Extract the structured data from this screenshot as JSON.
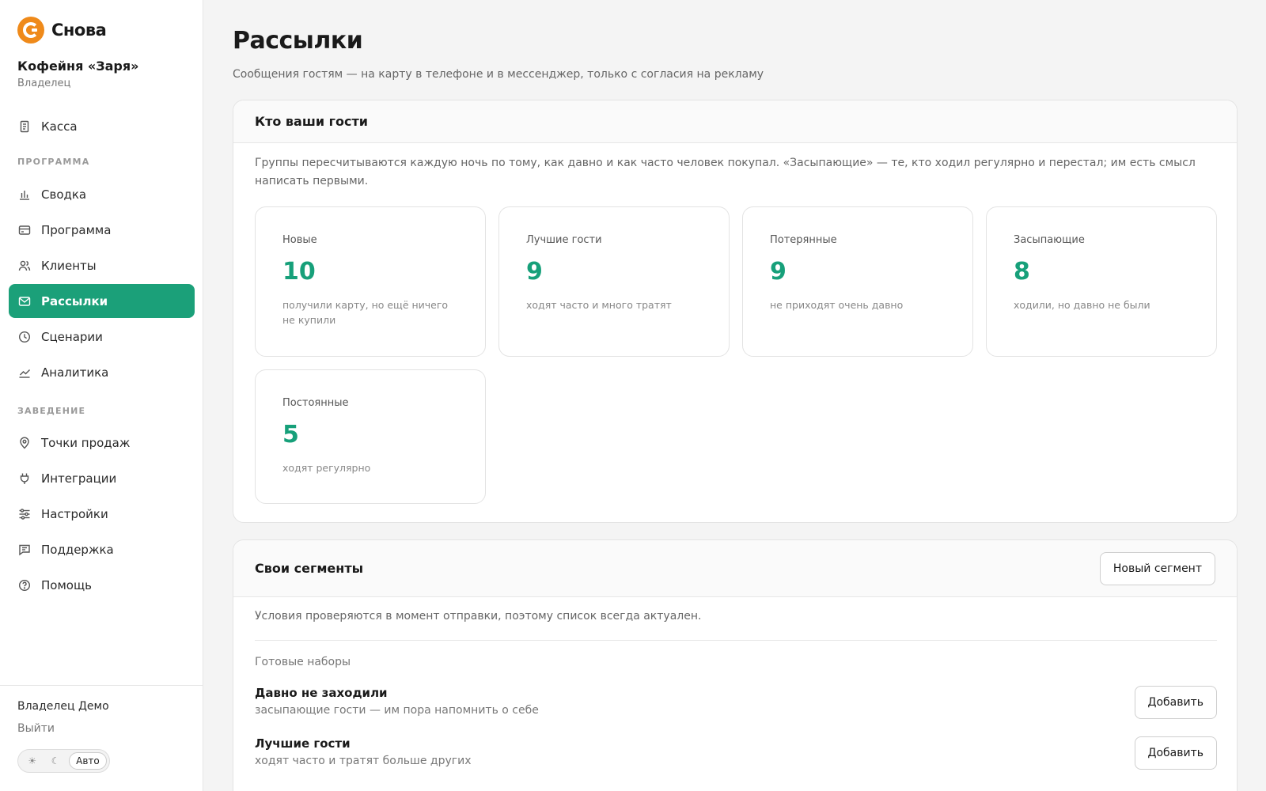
{
  "brand": {
    "name": "Снова",
    "accent": "#ef8a1a"
  },
  "org": {
    "name": "Кофейня «Заря»",
    "role": "Владелец"
  },
  "nav": {
    "top": [
      {
        "label": "Касса",
        "icon": "receipt-icon"
      }
    ],
    "section_program": "ПРОГРАММА",
    "program": [
      {
        "label": "Сводка",
        "icon": "bar-chart-icon"
      },
      {
        "label": "Программа",
        "icon": "card-icon"
      },
      {
        "label": "Клиенты",
        "icon": "users-icon"
      },
      {
        "label": "Рассылки",
        "icon": "mail-icon",
        "active": true
      },
      {
        "label": "Сценарии",
        "icon": "clock-icon"
      },
      {
        "label": "Аналитика",
        "icon": "trend-icon"
      }
    ],
    "section_venue": "ЗАВЕДЕНИЕ",
    "venue": [
      {
        "label": "Точки продаж",
        "icon": "map-pin-icon"
      },
      {
        "label": "Интеграции",
        "icon": "plug-icon"
      },
      {
        "label": "Настройки",
        "icon": "sliders-icon"
      },
      {
        "label": "Поддержка",
        "icon": "chat-icon"
      },
      {
        "label": "Помощь",
        "icon": "help-icon"
      }
    ],
    "active_color": "#1ba079"
  },
  "footer": {
    "user": "Владелец Демо",
    "logout": "Выйти",
    "theme": {
      "light": "☀",
      "dark": "☾",
      "auto": "Авто",
      "selected": "Авто"
    }
  },
  "page": {
    "title": "Рассылки",
    "subtitle": "Сообщения гостям — на карту в телефоне и в мессенджер, только с согласия на рекламу"
  },
  "guests": {
    "title": "Кто ваши гости",
    "description": "Группы пересчитываются каждую ночь по тому, как давно и как часто человек покупал. «Засыпающие» — те, кто ходил регулярно и перестал; им есть смысл написать первыми.",
    "segments": [
      {
        "label": "Новые",
        "value": "10",
        "note": "получили карту, но ещё ничего не купили"
      },
      {
        "label": "Лучшие гости",
        "value": "9",
        "note": "ходят часто и много тратят"
      },
      {
        "label": "Потерянные",
        "value": "9",
        "note": "не приходят очень давно"
      },
      {
        "label": "Засыпающие",
        "value": "8",
        "note": "ходили, но давно не были"
      },
      {
        "label": "Постоянные",
        "value": "5",
        "note": "ходят регулярно"
      }
    ],
    "value_color": "#17a07a"
  },
  "custom": {
    "title": "Свои сегменты",
    "new_button": "Новый сегмент",
    "description": "Условия проверяются в момент отправки, поэтому список всегда актуален.",
    "presets_label": "Готовые наборы",
    "presets": [
      {
        "title": "Давно не заходили",
        "subtitle": "засыпающие гости — им пора напомнить о себе",
        "button": "Добавить"
      },
      {
        "title": "Лучшие гости",
        "subtitle": "ходят часто и тратят больше других",
        "button": "Добавить"
      }
    ]
  }
}
